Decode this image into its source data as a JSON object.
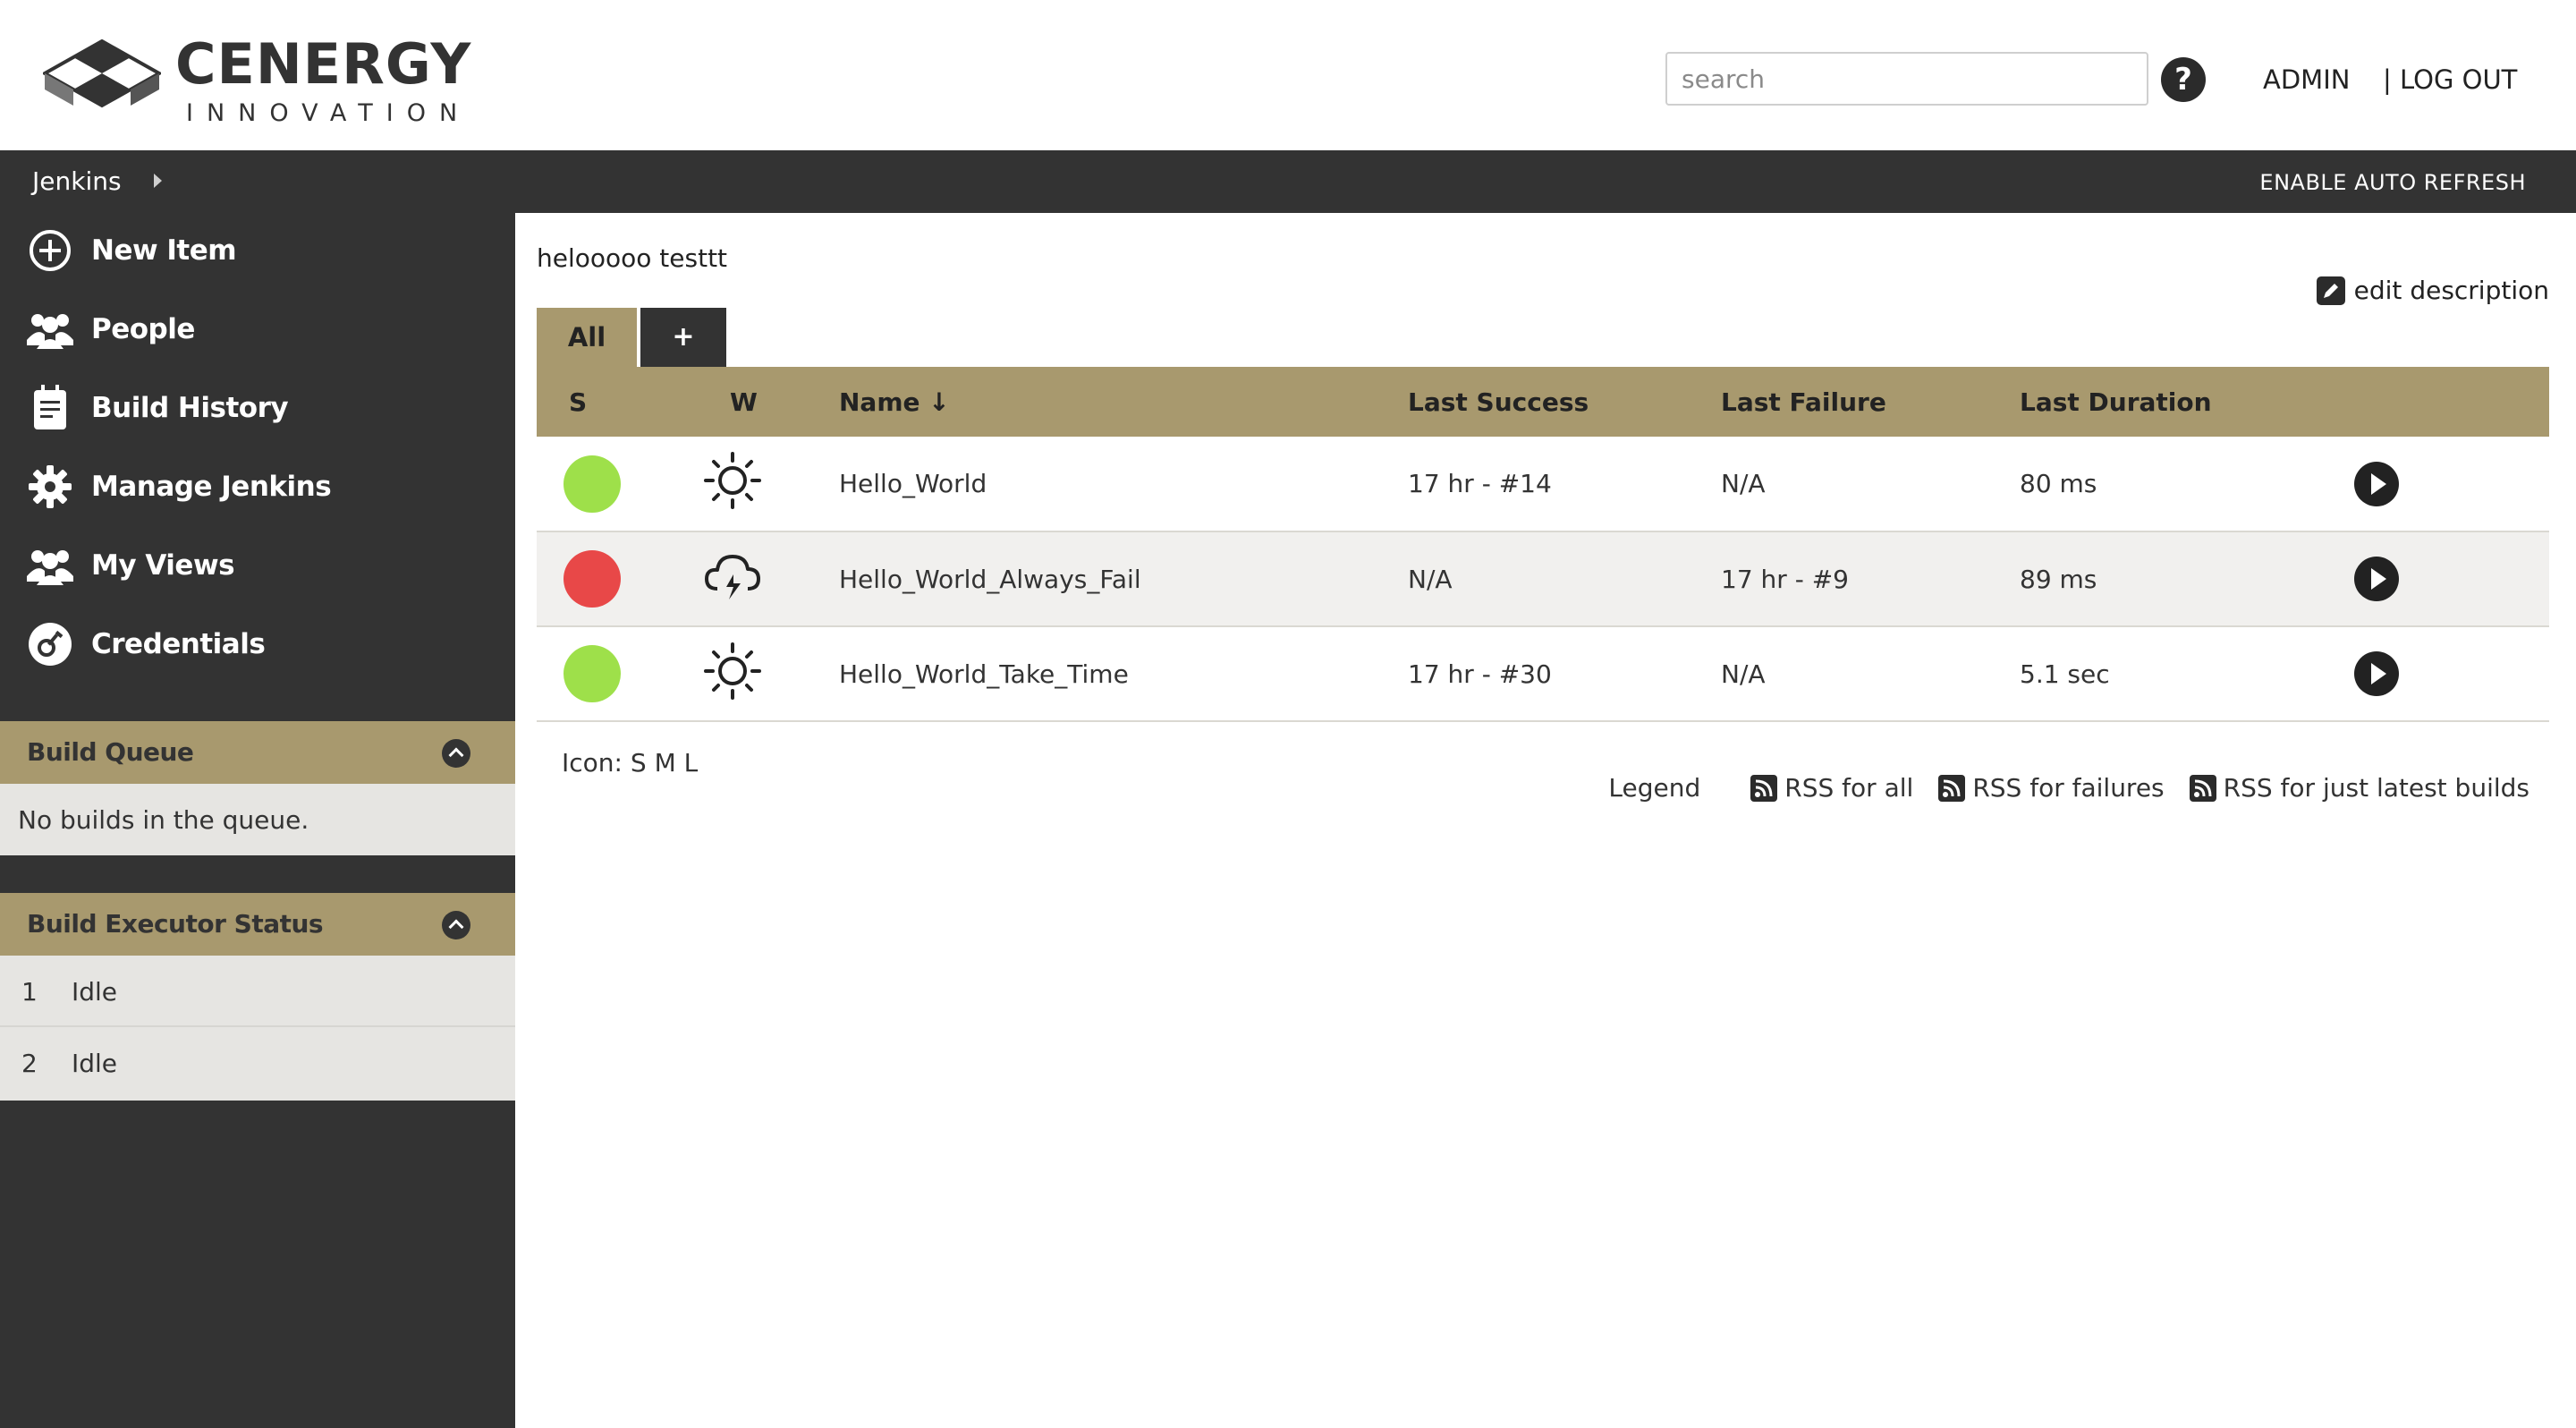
{
  "header": {
    "brand_name": "CENERGY",
    "brand_sub": "INNOVATION",
    "search_placeholder": "search",
    "help_icon": "?",
    "admin_label": "ADMIN",
    "logout_label": "| LOG OUT"
  },
  "breadcrumb": {
    "root": "Jenkins",
    "auto_refresh": "ENABLE AUTO REFRESH"
  },
  "sidebar": {
    "tasks": [
      {
        "label": "New Item",
        "icon": "plus-circle-icon"
      },
      {
        "label": "People",
        "icon": "people-icon"
      },
      {
        "label": "Build History",
        "icon": "notepad-icon"
      },
      {
        "label": "Manage Jenkins",
        "icon": "gear-icon"
      },
      {
        "label": "My Views",
        "icon": "people-icon"
      },
      {
        "label": "Credentials",
        "icon": "key-icon"
      }
    ],
    "build_queue": {
      "title": "Build Queue",
      "empty_text": "No builds in the queue."
    },
    "executors": {
      "title": "Build Executor Status",
      "rows": [
        {
          "num": "1",
          "status": "Idle"
        },
        {
          "num": "2",
          "status": "Idle"
        }
      ]
    }
  },
  "main": {
    "description": "helooooo testtt",
    "edit_description": "edit description",
    "tabs": {
      "all": "All",
      "add": "+"
    },
    "columns": {
      "s": "S",
      "w": "W",
      "name": "Name ↓",
      "last_success": "Last Success",
      "last_failure": "Last Failure",
      "last_duration": "Last Duration"
    },
    "jobs": [
      {
        "status_color": "#9ee04a",
        "weather": "sunny-icon",
        "name": "Hello_World",
        "last_success": "17 hr - #14",
        "last_failure": "N/A",
        "last_duration": "80 ms"
      },
      {
        "status_color": "#e84848",
        "weather": "thunderstorm-icon",
        "name": "Hello_World_Always_Fail",
        "last_success": "N/A",
        "last_failure": "17 hr - #9",
        "last_duration": "89 ms"
      },
      {
        "status_color": "#9ee04a",
        "weather": "sunny-icon",
        "name": "Hello_World_Take_Time",
        "last_success": "17 hr - #30",
        "last_failure": "N/A",
        "last_duration": "5.1 sec"
      }
    ],
    "icon_size_label": "Icon:",
    "icon_sizes": [
      "S",
      "M",
      "L"
    ],
    "legend": "Legend",
    "rss_all": "RSS for all",
    "rss_failures": "RSS for failures",
    "rss_latest": "RSS for just latest builds"
  },
  "colors": {
    "accent": "#a8996e",
    "dark": "#333333",
    "success": "#9ee04a",
    "failure": "#e84848"
  }
}
